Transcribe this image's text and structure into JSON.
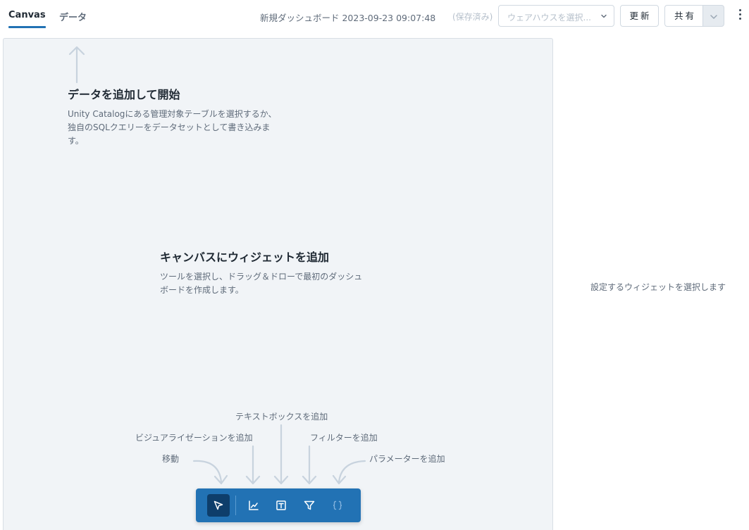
{
  "tabs": [
    {
      "label": "Canvas",
      "active": true
    },
    {
      "label": "データ",
      "active": false
    }
  ],
  "header": {
    "dashboard_title": "新規ダッシュボード 2023-09-23 09:07:48",
    "saved_status": "(保存済み)",
    "warehouse_placeholder": "ウェアハウスを選択...",
    "update_label": "更新",
    "share_label": "共有"
  },
  "canvas": {
    "add_data": {
      "title": "データを追加して開始",
      "description": "Unity Catalogにある管理対象テーブルを選択するか、独自のSQLクエリーをデータセットとして書き込みます。"
    },
    "add_widget": {
      "title": "キャンバスにウィジェットを追加",
      "description": "ツールを選択し、ドラッグ＆ドローで最初のダッシュボードを作成します。"
    },
    "tool_hints": {
      "textbox": "テキストボックスを追加",
      "visualization": "ビジュアライゼーションを追加",
      "filter": "フィルターを追加",
      "move": "移動",
      "parameter": "パラメーターを追加"
    }
  },
  "toolbar": {
    "tools": [
      {
        "name": "move",
        "icon": "cursor-arrow-icon",
        "active": true
      },
      {
        "name": "visualization",
        "icon": "line-chart-icon",
        "active": false
      },
      {
        "name": "textbox",
        "icon": "text-box-icon",
        "active": false
      },
      {
        "name": "filter",
        "icon": "filter-funnel-icon",
        "active": false
      },
      {
        "name": "parameter",
        "icon": "curly-braces-icon",
        "active": false,
        "disabled": true
      }
    ]
  },
  "side_panel": {
    "empty_message": "設定するウィジェットを選択します"
  },
  "colors": {
    "accent": "#2272b4",
    "canvas_bg": "#f1f4f7",
    "active_tool": "#0e3e6b",
    "hint_arrow": "#c8d3de"
  }
}
